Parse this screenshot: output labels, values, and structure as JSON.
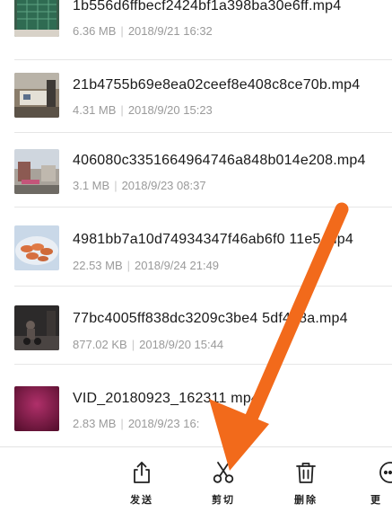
{
  "files": [
    {
      "name": "1b556d6ffbecf2424bf1a398ba30e6ff.mp4",
      "size": "6.36 MB",
      "date": "2018/9/21 16:32",
      "thumb": "green-board-thumbnail"
    },
    {
      "name": "21b4755b69e8ea02ceef8e408c8ce70b.mp4",
      "size": "4.31 MB",
      "date": "2018/9/20 15:23",
      "thumb": "street-stall-thumbnail"
    },
    {
      "name": "406080c3351664964746a848b014e208.mp4",
      "size": "3.1 MB",
      "date": "2018/9/23 08:37",
      "thumb": "building-thumbnail"
    },
    {
      "name": "4981bb7a10d74934347f46ab6f0  11e5.mp4",
      "size": "22.53 MB",
      "date": "2018/9/24 21:49",
      "thumb": "food-plate-thumbnail"
    },
    {
      "name": "77bc4005ff838dc3209c3be4  5df488a.mp4",
      "size": "877.02 KB",
      "date": "2018/9/20 15:44",
      "thumb": "night-rider-thumbnail"
    },
    {
      "name": "VID_20180923_162311  mp4",
      "size": "2.83 MB",
      "date": "2018/9/23 16:",
      "thumb": "magenta-thumbnail"
    }
  ],
  "toolbar": {
    "send": "发送",
    "cut": "剪切",
    "delete": "删除",
    "more": "更"
  },
  "colors": {
    "arrow": "#f26a1b",
    "meta_text": "#9a9a9a"
  }
}
